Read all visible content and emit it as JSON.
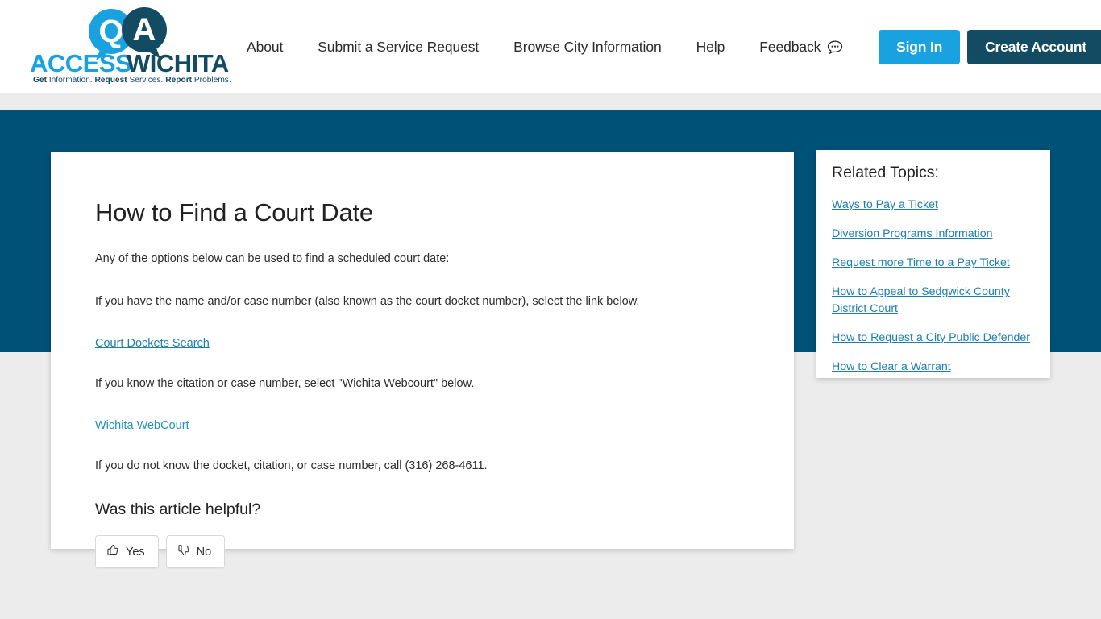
{
  "header": {
    "logo": {
      "bubble_q": "Q",
      "bubble_a": "A",
      "word_access": "ACCESS",
      "word_wichita": "WICHITA",
      "tagline_get": "Get",
      "tagline_information": "Information.",
      "tagline_request": "Request",
      "tagline_services": "Services.",
      "tagline_report": "Report",
      "tagline_problems": "Problems.",
      "color_light": "#1aa2e0",
      "color_dark": "#134b63"
    },
    "nav": [
      {
        "label": "About",
        "name": "nav-item-about"
      },
      {
        "label": "Submit a Service Request",
        "name": "nav-item-submit-service-request"
      },
      {
        "label": "Browse City Information",
        "name": "nav-item-browse-city-information"
      },
      {
        "label": "Help",
        "name": "nav-item-help"
      },
      {
        "label": "Feedback",
        "name": "nav-item-feedback",
        "icon": "speech-bubble-icon"
      }
    ],
    "sign_in_label": "Sign In",
    "create_account_label": "Create Account",
    "sign_in_color": "#1aa2e0",
    "create_account_color": "#134b63"
  },
  "hero": {
    "background_color": "#005177"
  },
  "article": {
    "title": "How to Find a Court Date",
    "paragraph_1": "Any of the options below can be used to find a scheduled court date:",
    "paragraph_2": "If you have the name and/or case number (also known as the court docket number), select the link below.",
    "link_1": "Court Dockets Search",
    "paragraph_3": "If you know the citation or case number, select \"Wichita Webcourt\" below.",
    "link_2": "Wichita WebCourt",
    "paragraph_4": "If you do not know the docket, citation, or case number, call (316) 268-4611.",
    "helpful_heading": "Was this article helpful?",
    "vote_yes_label": "Yes",
    "vote_no_label": "No",
    "link_color": "#1d7fae"
  },
  "related": {
    "title": "Related Topics:",
    "links": [
      "Ways to Pay a Ticket",
      "Diversion Programs Information",
      "Request more Time to a Pay Ticket",
      "How to Appeal to Sedgwick County District Court",
      "How to Request a City Public Defender",
      "How to Clear a Warrant"
    ]
  },
  "page": {
    "background_color": "#ececec"
  }
}
